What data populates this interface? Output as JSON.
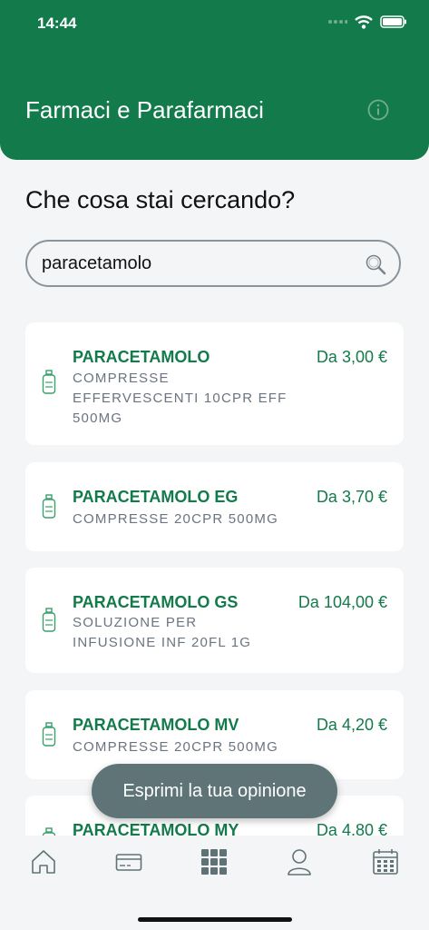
{
  "status": {
    "time": "14:44"
  },
  "header": {
    "title": "Farmaci e Parafarmaci"
  },
  "main": {
    "question": "Che cosa stai cercando?"
  },
  "search": {
    "value": "paracetamolo",
    "placeholder": ""
  },
  "results": [
    {
      "name": "PARACETAMOLO",
      "desc_lines": [
        "COMPRESSE",
        "EFFERVESCENTI 10CPR EFF",
        "500MG"
      ],
      "price": "Da 3,00 €"
    },
    {
      "name": "PARACETAMOLO EG",
      "desc_lines": [
        "COMPRESSE 20CPR 500MG"
      ],
      "price": "Da 3,70 €"
    },
    {
      "name": "PARACETAMOLO GS",
      "desc_lines": [
        "SOLUZIONE PER",
        "INFUSIONE INF 20FL 1G"
      ],
      "price": "Da 104,00 €"
    },
    {
      "name": "PARACETAMOLO MV",
      "desc_lines": [
        "COMPRESSE 20CPR 500MG"
      ],
      "price": "Da 4,20 €"
    },
    {
      "name": "PARACETAMOLO MY",
      "desc_lines": [],
      "price": "Da 4,80 €"
    }
  ],
  "toast": {
    "label": "Esprimi la tua opinione"
  },
  "tabs": [
    "home-icon",
    "card-icon",
    "grid-icon",
    "user-icon",
    "calendar-icon"
  ],
  "colors": {
    "brand": "#137a4b",
    "background": "#f4f5f6",
    "toast": "#5e7477"
  }
}
